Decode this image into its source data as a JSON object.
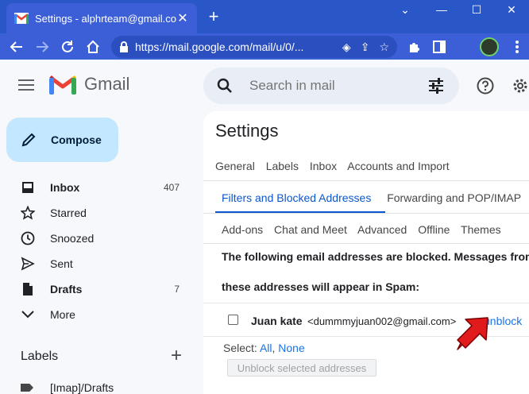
{
  "browser": {
    "tab_title": "Settings - alphrteam@gmail.com",
    "url": "https://mail.google.com/mail/u/0/...",
    "accent": "#2a57c8"
  },
  "gmail": {
    "wordmark": "Gmail",
    "search_placeholder": "Search in mail"
  },
  "sidebar": {
    "compose_label": "Compose",
    "items": [
      {
        "label": "Inbox",
        "count": "407",
        "icon": "inbox-icon",
        "bold": true
      },
      {
        "label": "Starred",
        "count": "",
        "icon": "star-icon",
        "bold": false
      },
      {
        "label": "Snoozed",
        "count": "",
        "icon": "clock-icon",
        "bold": false
      },
      {
        "label": "Sent",
        "count": "",
        "icon": "send-icon",
        "bold": false
      },
      {
        "label": "Drafts",
        "count": "7",
        "icon": "draft-icon",
        "bold": true
      },
      {
        "label": "More",
        "count": "",
        "icon": "chevron-down-icon",
        "bold": false
      }
    ],
    "labels_header": "Labels",
    "labels": [
      {
        "label": "[Imap]/Drafts"
      }
    ]
  },
  "settings": {
    "title": "Settings",
    "tabs_row1": [
      "General",
      "Labels",
      "Inbox",
      "Accounts and Import"
    ],
    "tabs_row2": [
      "Filters and Blocked Addresses",
      "Forwarding and POP/IMAP"
    ],
    "tabs_row3": [
      "Add-ons",
      "Chat and Meet",
      "Advanced",
      "Offline",
      "Themes"
    ],
    "active_tab": "Filters and Blocked Addresses",
    "blocked_message_line1": "The following email addresses are blocked. Messages from",
    "blocked_message_line2": "these addresses will appear in Spam:",
    "blocked_entries": [
      {
        "name": "Juan kate",
        "email": "<dummmyjuan002@gmail.com>",
        "action": "unblock"
      }
    ],
    "select_label": "Select:",
    "select_all": "All",
    "select_none": "None",
    "unblock_selected_label": "Unblock selected addresses"
  }
}
